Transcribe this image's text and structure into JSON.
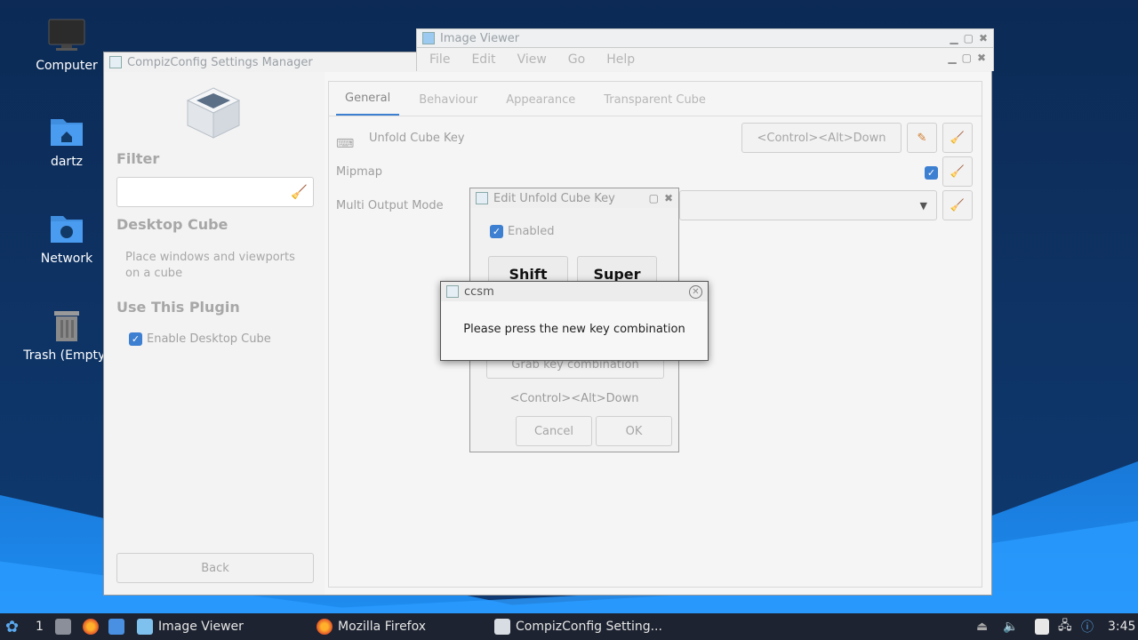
{
  "desktop": {
    "icons": [
      {
        "label": "Computer",
        "icon": "monitor-icon"
      },
      {
        "label": "dartz",
        "icon": "home-folder-icon"
      },
      {
        "label": "Network",
        "icon": "network-folder-icon"
      },
      {
        "label": "Trash (Empty)",
        "icon": "trash-icon"
      }
    ]
  },
  "ccsm": {
    "title": "CompizConfig Settings Manager",
    "filter_label": "Filter",
    "filter_placeholder": "",
    "plugin_title": "Desktop Cube",
    "plugin_desc": "Place windows and viewports on a cube",
    "use_plugin_label": "Use This Plugin",
    "enable_label": "Enable Desktop Cube",
    "back_label": "Back",
    "tabs": [
      "General",
      "Behaviour",
      "Appearance",
      "Transparent Cube"
    ],
    "settings": {
      "unfold_label": "Unfold Cube Key",
      "unfold_value": "<Control><Alt>Down",
      "mipmap_label": "Mipmap",
      "multi_output_label": "Multi Output Mode"
    }
  },
  "image_viewer": {
    "title": "Image Viewer",
    "menu": [
      "File",
      "Edit",
      "View",
      "Go",
      "Help"
    ]
  },
  "edit_dialog": {
    "title": "Edit Unfold Cube Key",
    "enabled_label": "Enabled",
    "shift_label": "Shift",
    "super_label": "Super",
    "grab_label": "Grab key combination",
    "current_value": "<Control><Alt>Down",
    "cancel_label": "Cancel",
    "ok_label": "OK"
  },
  "popup": {
    "title": "ccsm",
    "message": "Please press the new key combination"
  },
  "taskbar": {
    "workspace": "1",
    "tasks": [
      "Image Viewer",
      "Mozilla Firefox",
      "CompizConfig Setting..."
    ],
    "clock": "3:45"
  },
  "colors": {
    "accent": "#3d7fd1",
    "taskbar_bg": "#1d2330",
    "desktop_bg": "#0e3466"
  }
}
